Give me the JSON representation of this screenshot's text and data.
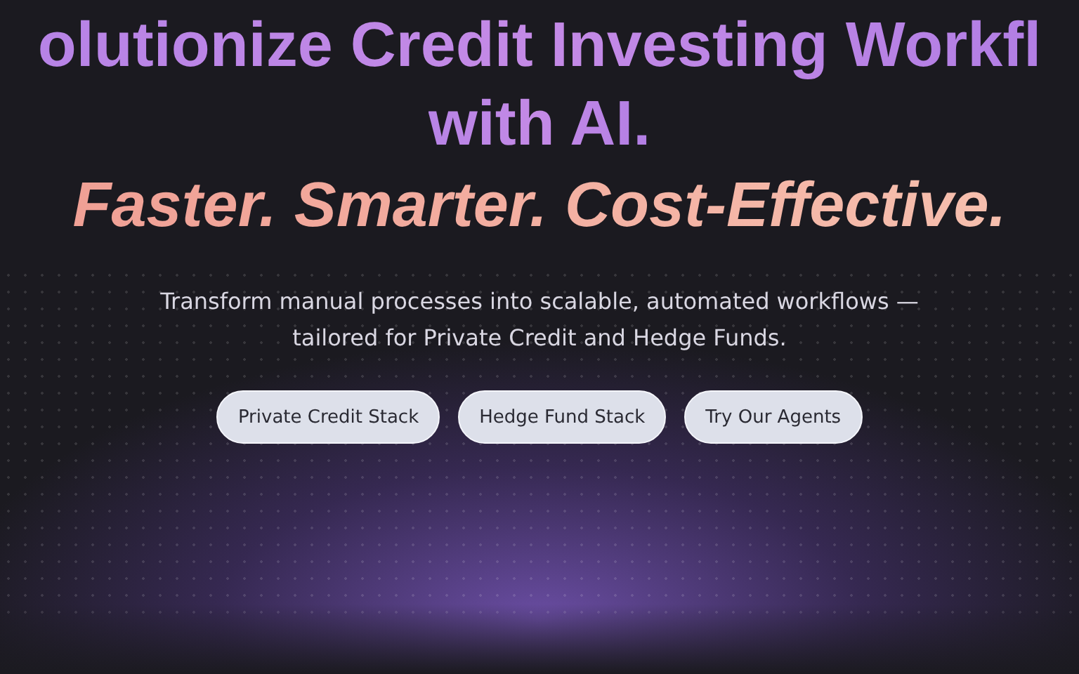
{
  "hero": {
    "headline_lines": [
      "olutionize Credit Investing Workfl",
      "with AI."
    ],
    "tagline": "Faster. Smarter. Cost-Effective.",
    "subtitle_lines": [
      "Transform manual processes into scalable, automated workflows —",
      "tailored for Private Credit and Hedge Funds."
    ],
    "buttons": [
      "Private Credit Stack",
      "Hedge Fund Stack",
      "Try Our Agents"
    ]
  }
}
